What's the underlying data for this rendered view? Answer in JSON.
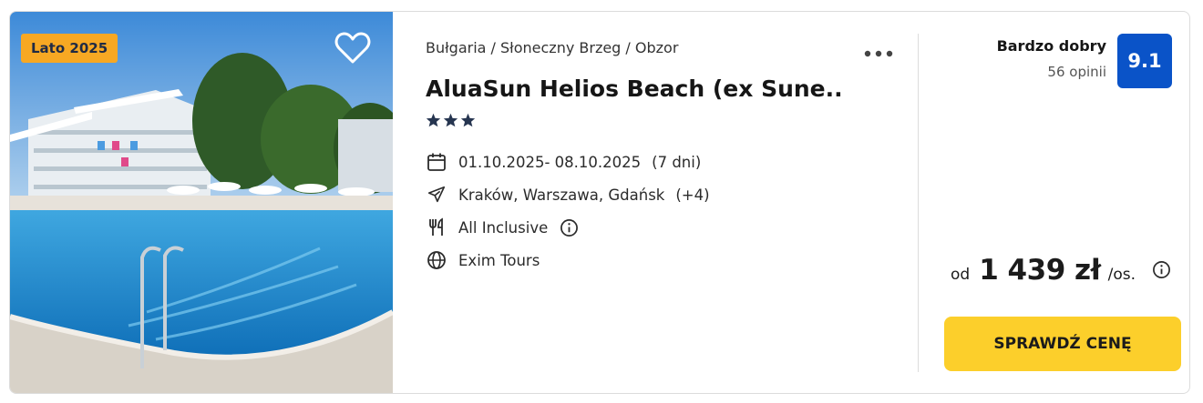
{
  "photo": {
    "season_badge": "Lato 2025",
    "badge_color": "#f7a823",
    "favorite_icon": "heart-outline-icon"
  },
  "location": {
    "breadcrumb": "Bułgaria / Słoneczny Brzeg / Obzor"
  },
  "hotel": {
    "name": "AluaSun Helios Beach (ex Sune...",
    "stars": 3
  },
  "details": {
    "dates": "01.10.2025- 08.10.2025",
    "duration": "(7 dni)",
    "departures": "Kraków, Warszawa, Gdańsk",
    "departures_more": "(+4)",
    "board": "All Inclusive",
    "operator": "Exim Tours"
  },
  "rating": {
    "label": "Bardzo dobry",
    "reviews": "56 opinii",
    "score": "9.1",
    "score_color": "#0a53c8"
  },
  "price": {
    "prefix": "od",
    "amount": "1 439 zł",
    "suffix": "/os."
  },
  "cta": {
    "label": "SPRAWDŹ CENĘ",
    "color": "#fccf2b"
  },
  "icons": {
    "more": "more-dots-icon",
    "calendar": "calendar-icon",
    "plane": "plane-icon",
    "board": "cutlery-icon",
    "operator": "globe-icon",
    "info": "info-icon",
    "star": "star-icon"
  }
}
